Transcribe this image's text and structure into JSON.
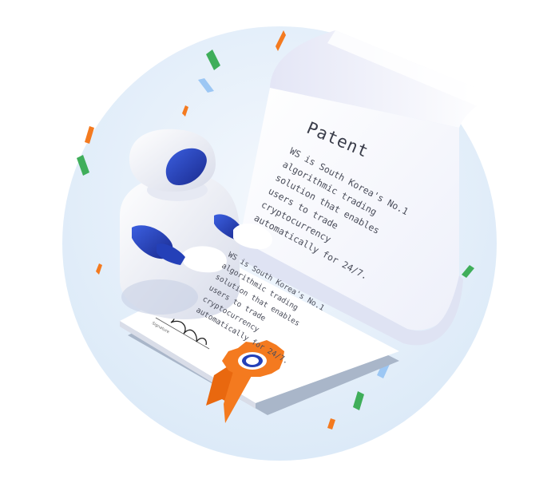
{
  "scroll": {
    "title": "Patent",
    "lines": [
      "WS is South Korea's No.1",
      "algorithmic trading",
      "solution that enables",
      "users to trade",
      "cryptocurrency",
      "automatically for 24/7."
    ]
  },
  "certificate": {
    "lines": [
      "WS is South Korea's No.1",
      "algorithmic trading",
      "solution that enables",
      "users to trade",
      "cryptocurrency",
      "automatically for 24/7."
    ],
    "signature_label": "Signature"
  },
  "colors": {
    "background_circle": "#e6f0fb",
    "robot_blue": "#2440b8",
    "ribbon_orange": "#f47a1f",
    "confetti_green": "#3fae5a"
  }
}
